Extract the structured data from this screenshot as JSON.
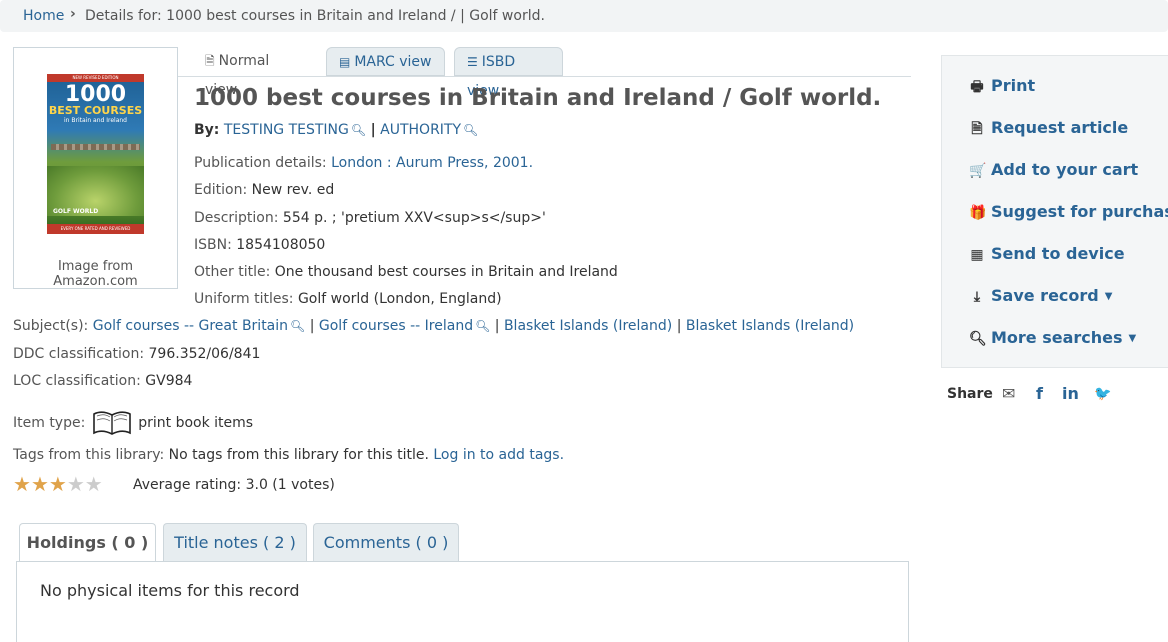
{
  "breadcrumb": {
    "home": "Home",
    "separator": "›",
    "current": "Details for: 1000 best courses in Britain and Ireland / | Golf world."
  },
  "cover": {
    "caption": "Image from Amazon.com",
    "band_text": "NEW REVISED EDITION",
    "big_text": "1000",
    "sub_text": "BEST COURSES",
    "sub2_text": "in Britain and Ireland",
    "logo_text": "GOLF WORLD",
    "foot_text": "EVERY ONE RATED AND REVIEWED"
  },
  "view_tabs": {
    "normal": "Normal view",
    "marc": "MARC view",
    "isbd": "ISBD view"
  },
  "record": {
    "title": "1000 best courses in Britain and Ireland / Golf world.",
    "by_label": "By:",
    "author1": "TESTING TESTING",
    "author_sep": "|",
    "author2": "AUTHORITY",
    "pub_label": "Publication details:",
    "pub_value": "London : Aurum Press, 2001.",
    "edition_label": "Edition:",
    "edition_value": "New rev. ed",
    "desc_label": "Description:",
    "desc_value": "554 p. ; 'pretium XXV<sup>s</sup>'",
    "isbn_label": "ISBN:",
    "isbn_value": "1854108050",
    "other_title_label": "Other title:",
    "other_title_value": "One thousand best courses in Britain and Ireland",
    "uniform_label": "Uniform titles:",
    "uniform_value": "Golf world (London, England)",
    "subjects_label": "Subject(s):",
    "subjects": [
      "Golf courses -- Great Britain",
      "Golf courses -- Ireland",
      "Blasket Islands (Ireland)",
      "Blasket Islands (Ireland)"
    ],
    "sep": "|",
    "ddc_label": "DDC classification:",
    "ddc_value": "796.352/06/841",
    "loc_label": "LOC classification:",
    "loc_value": "GV984",
    "itemtype_label": "Item type:",
    "itemtype_value": "print book items",
    "tags_label": "Tags from this library:",
    "tags_value": "No tags from this library for this title.",
    "tags_login": "Log in to add tags.",
    "rating": 3,
    "rating_max": 5,
    "rating_text": "Average rating: 3.0 (1 votes)"
  },
  "holdings_tabs": {
    "holdings": "Holdings ( 0 )",
    "title_notes": "Title notes ( 2 )",
    "comments": "Comments ( 0 )",
    "message": "No physical items for this record"
  },
  "actions": {
    "print": "Print",
    "request_article": "Request article",
    "add_cart": "Add to your cart",
    "suggest": "Suggest for purchase",
    "send_device": "Send to device",
    "save_record": "Save record",
    "more_searches": "More searches"
  },
  "share": {
    "label": "Share",
    "email_icon": "✉",
    "facebook_icon": "f",
    "linkedin_icon": "in",
    "twitter_icon": "🐦"
  },
  "colors": {
    "link": "#2a6495",
    "star_on": "#e0a34a",
    "star_off": "#cccccc"
  }
}
